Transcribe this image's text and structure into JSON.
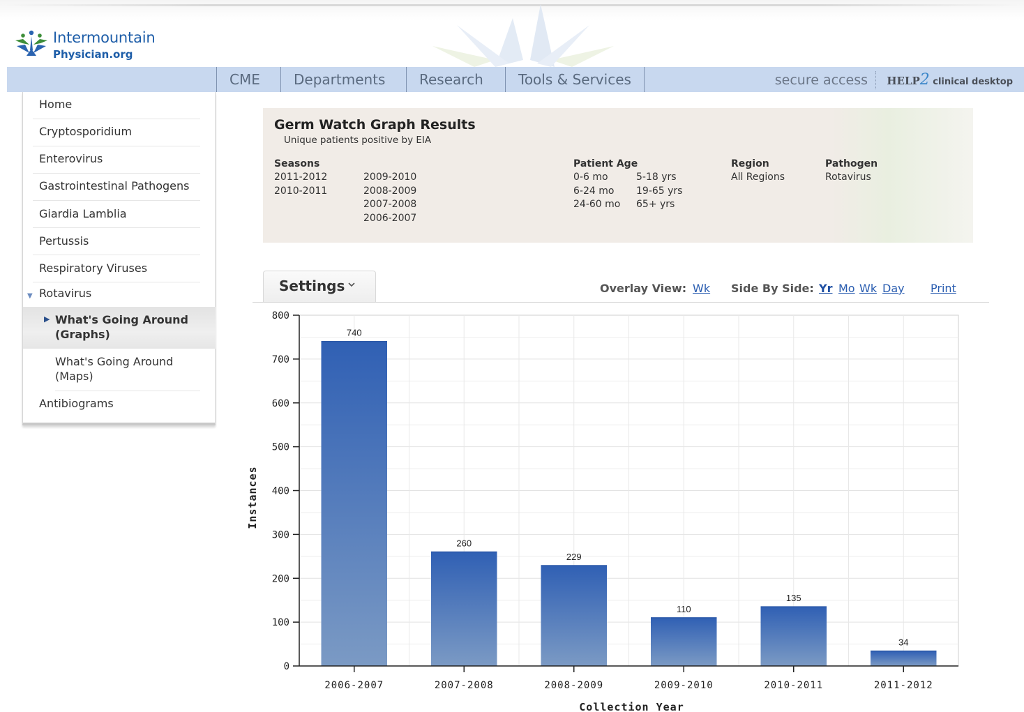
{
  "header": {
    "logo_line1": "Intermountain",
    "logo_line2": "Physician.org"
  },
  "nav": {
    "items": [
      {
        "label": "CME"
      },
      {
        "label": "Departments"
      },
      {
        "label": "Research"
      },
      {
        "label": "Tools & Services"
      }
    ],
    "secure_access": "secure access",
    "help2_a": "HELP",
    "help2_b": "2",
    "help2_c": "clinical desktop"
  },
  "sidebar": {
    "items": [
      {
        "label": "Home"
      },
      {
        "label": "Cryptosporidium"
      },
      {
        "label": "Enterovirus"
      },
      {
        "label": "Gastrointestinal Pathogens"
      },
      {
        "label": "Giardia Lamblia"
      },
      {
        "label": "Pertussis"
      },
      {
        "label": "Respiratory Viruses"
      },
      {
        "label": "Rotavirus"
      },
      {
        "label": "Antibiograms"
      }
    ],
    "sub_active_line1": "What's Going Around",
    "sub_active_line2": "(Graphs)",
    "sub_maps_line1": "What's Going Around",
    "sub_maps_line2": "(Maps)"
  },
  "results": {
    "title": "Germ Watch Graph Results",
    "subtitle": "Unique patients positive by EIA",
    "seasons_header": "Seasons",
    "seasons_col1": [
      "2011-2012",
      "2010-2011"
    ],
    "seasons_col2": [
      "2009-2010",
      "2008-2009",
      "2007-2008",
      "2006-2007"
    ],
    "age_header": "Patient Age",
    "age_col1": [
      "0-6 mo",
      "6-24 mo",
      "24-60 mo"
    ],
    "age_col2": [
      "5-18 yrs",
      "19-65 yrs",
      "65+ yrs"
    ],
    "region_header": "Region",
    "region_value": "All Regions",
    "pathogen_header": "Pathogen",
    "pathogen_value": "Rotavirus"
  },
  "controls": {
    "settings_label": "Settings",
    "overlay_label": "Overlay View:",
    "overlay_wk": "Wk",
    "sbs_label": "Side By Side:",
    "sbs_yr": "Yr",
    "sbs_mo": "Mo",
    "sbs_wk": "Wk",
    "sbs_day": "Day",
    "print": "Print"
  },
  "colors": {
    "bar_top": "#3060b4",
    "bar_bottom": "#7b9ac4",
    "link": "#2a5db0",
    "nav_bg": "#c8d8ef"
  },
  "chart_data": {
    "type": "bar",
    "categories": [
      "2006-2007",
      "2007-2008",
      "2008-2009",
      "2009-2010",
      "2010-2011",
      "2011-2012"
    ],
    "values": [
      740,
      260,
      229,
      110,
      135,
      34
    ],
    "data_labels": [
      "740",
      "260",
      "229",
      "110",
      "135",
      "34"
    ],
    "xlabel": "Collection Year",
    "ylabel": "Instances",
    "ylim": [
      0,
      800
    ],
    "yticks": [
      "0",
      "100",
      "200",
      "300",
      "400",
      "500",
      "600",
      "700",
      "800"
    ],
    "grid": true,
    "legend": "none"
  }
}
